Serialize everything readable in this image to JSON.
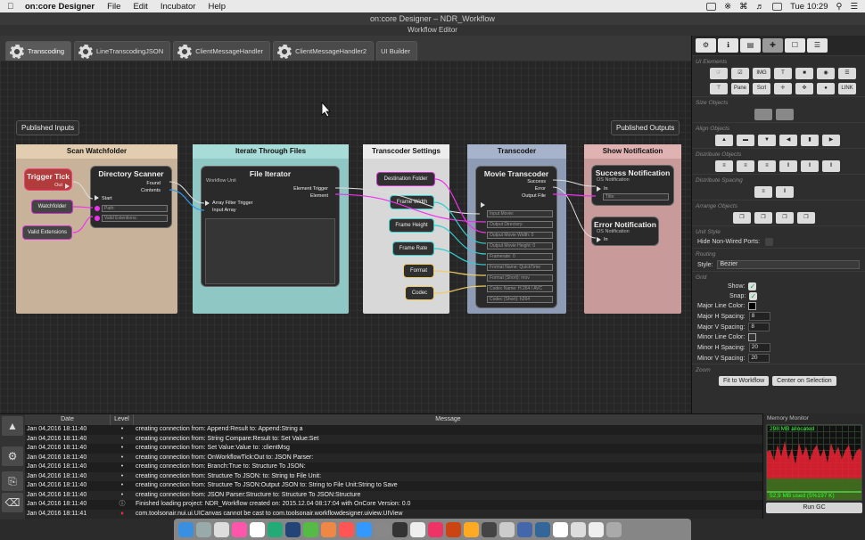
{
  "menubar": {
    "app": "on:core Designer",
    "items": [
      "File",
      "Edit",
      "Incubator",
      "Help"
    ],
    "clock": "Tue 10:29"
  },
  "window": {
    "title": "on:core Designer – NDR_Workflow",
    "subtitle": "Workflow Editor"
  },
  "tabs": [
    {
      "label": "Transcoding"
    },
    {
      "label": "LineTranscodingJSON"
    },
    {
      "label": "ClientMessageHandler"
    },
    {
      "label": "ClientMessageHandler2"
    },
    {
      "label": "UI Builder"
    }
  ],
  "canvas": {
    "published_inputs": "Published Inputs",
    "published_outputs": "Published Outputs",
    "groups": {
      "scan": "Scan Watchfolder",
      "iterate": "Iterate Through Files",
      "settings": "Transcoder Settings",
      "transcoder": "Transcoder",
      "notify": "Show Notification"
    },
    "trigger_tick": {
      "title": "Trigger Tick",
      "out": "Out"
    },
    "watchfolder": "Watchfolder",
    "valid_extensions": "Valid Extensions",
    "dir_scanner": {
      "title": "Directory Scanner",
      "found": "Found",
      "contents": "Contents",
      "start": "Start",
      "path": "Path:",
      "valid_ext": "Valid Extentions:"
    },
    "file_iterator": {
      "title": "File Iterator",
      "sub": "Workflow Unit",
      "element_trigger": "Element Trigger",
      "element": "Element",
      "array_filter": "Array Filter Trigger",
      "input_array": "Input Array"
    },
    "settings_pills": [
      "Destination Folder",
      "Frame Width",
      "Frame Height",
      "Frame Rate",
      "Format",
      "Codec"
    ],
    "movie_transcoder": {
      "title": "Movie Transcoder",
      "success": "Success",
      "error": "Error",
      "output_file": "Output File",
      "fields": [
        "Input Movie:",
        "Output Directory:",
        "Output Movie Width: 0",
        "Output Movie Height: 0",
        "Framerate: 0",
        "Format Name: QuickTime",
        "Format (Short): mov",
        "Codec Name: H.264 / AVC",
        "Codec (Short): h264"
      ]
    },
    "success_notification": {
      "title": "Success Notification",
      "sub": "OS Notification",
      "in": "In",
      "title_field": "Title:"
    },
    "error_notification": {
      "title": "Error Notification",
      "sub": "OS Notification",
      "in": "In"
    }
  },
  "right_panel": {
    "sections": {
      "ui_elements": "UI Elements",
      "size_objects": "Size Objects",
      "align_objects": "Align Objects",
      "distribute_objects": "Distribute Objects",
      "distribute_spacing": "Distribute Spacing",
      "arrange_objects": "Arrange Objects",
      "unit_style": "Unit Style",
      "routing": "Routing",
      "grid": "Grid",
      "zoom": "Zoom"
    },
    "ui_element_labels": [
      "IMG",
      "T",
      "Pane",
      "Scrl",
      "LINK"
    ],
    "hide_non_wired": "Hide Non-Wired Ports:",
    "style_label": "Style:",
    "style_value": "Bezier",
    "show": "Show:",
    "snap": "Snap:",
    "major_line_color": "Major Line Color:",
    "major_h": {
      "label": "Major H Spacing:",
      "value": "8"
    },
    "major_v": {
      "label": "Major V Spacing:",
      "value": "8"
    },
    "minor_line_color": "Minor Line Color:",
    "minor_h": {
      "label": "Minor H Spacing:",
      "value": "20"
    },
    "minor_v": {
      "label": "Minor V Spacing:",
      "value": "20"
    },
    "fit_btn": "Fit to Workflow",
    "center_btn": "Center on Selection"
  },
  "log": {
    "columns": [
      "Date",
      "Level",
      "Message"
    ],
    "rows": [
      {
        "date": "Jan 04,2016 18:11:40",
        "msg": "creating connection from: Append:Result to: Append:String a"
      },
      {
        "date": "Jan 04,2016 18:11:40",
        "msg": "creating connection from: String Compare:Result to: Set Value:Set"
      },
      {
        "date": "Jan 04,2016 18:11:40",
        "msg": "creating connection from: Set Value:Value to: :clientMsg"
      },
      {
        "date": "Jan 04,2016 18:11:40",
        "msg": "creating connection from: OnWorkflowTick:Out to: JSON Parser:"
      },
      {
        "date": "Jan 04,2016 18:11:40",
        "msg": "creating connection from: Branch:True to: Structure To JSON:"
      },
      {
        "date": "Jan 04,2016 18:11:40",
        "msg": "creating connection from: Structure To JSON: to: String to File Unit:"
      },
      {
        "date": "Jan 04,2016 18:11:40",
        "msg": "creating connection from: Structure To JSON:Output JSON to: String to File Unit:String to Save"
      },
      {
        "date": "Jan 04,2016 18:11:40",
        "msg": "creating connection from: JSON Parser:Structure to: Structure To JSON:Structure"
      },
      {
        "date": "Jan 04,2016 18:11:40",
        "msg": "Finished loading project: NDR_Workflow created on: 2015.12.04 08:17:04 with OnCore Version: 0.0"
      },
      {
        "date": "Jan 04,2016 18:11:41",
        "msg": "com.toolsonair.nui.ui.UICanvas cannot be cast to com.toolsonair.workflowdesigner.uiview.UIView"
      }
    ]
  },
  "memory": {
    "title": "Memory Monitor",
    "allocated": "298 MB allocated",
    "used": "52,9 MB used (5%197 K)",
    "run_gc": "Run GC"
  }
}
